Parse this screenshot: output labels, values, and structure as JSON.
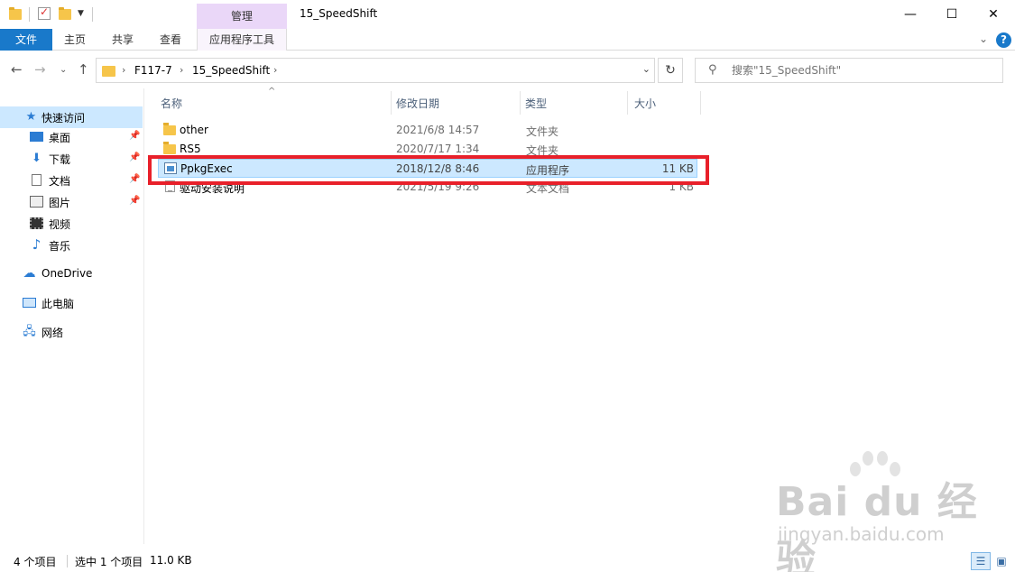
{
  "window": {
    "title": "15_SpeedShift",
    "manage_tab": "管理",
    "minimize": "—",
    "maximize": "☐",
    "close": "✕"
  },
  "ribbon": {
    "tabs": [
      "文件",
      "主页",
      "共享",
      "查看",
      "应用程序工具"
    ],
    "help": "?"
  },
  "address": {
    "crumbs": [
      "F117-7",
      "15_SpeedShift"
    ],
    "search_placeholder": "搜索\"15_SpeedShift\""
  },
  "sidebar": {
    "items": [
      {
        "label": "快速访问",
        "icon": "star-icon",
        "pinned": false,
        "selected": true
      },
      {
        "label": "桌面",
        "icon": "desktop-icon",
        "pinned": true
      },
      {
        "label": "下载",
        "icon": "download-icon",
        "pinned": true
      },
      {
        "label": "文档",
        "icon": "document-icon",
        "pinned": true
      },
      {
        "label": "图片",
        "icon": "picture-icon",
        "pinned": true
      },
      {
        "label": "视频",
        "icon": "video-icon",
        "pinned": false
      },
      {
        "label": "音乐",
        "icon": "music-icon",
        "pinned": false
      },
      {
        "label": "OneDrive",
        "icon": "cloud-icon"
      },
      {
        "label": "此电脑",
        "icon": "computer-icon"
      },
      {
        "label": "网络",
        "icon": "network-icon"
      }
    ]
  },
  "file_list": {
    "columns": [
      "名称",
      "修改日期",
      "类型",
      "大小"
    ],
    "rows": [
      {
        "name": "other",
        "date": "2021/6/8 14:57",
        "type": "文件夹",
        "size": "",
        "icon": "folder-icon"
      },
      {
        "name": "RS5",
        "date": "2020/7/17 1:34",
        "type": "文件夹",
        "size": "",
        "icon": "folder-icon"
      },
      {
        "name": "PpkgExec",
        "date": "2018/12/8 8:46",
        "type": "应用程序",
        "size": "11 KB",
        "icon": "application-icon",
        "selected": true
      },
      {
        "name": "驱动安装说明",
        "date": "2021/5/19 9:26",
        "type": "文本文档",
        "size": "1 KB",
        "icon": "text-document-icon"
      }
    ]
  },
  "status": {
    "item_count": "4 个项目",
    "selection": "选中 1 个项目",
    "size": "11.0 KB"
  },
  "watermark": {
    "logo": "Bai du 经验",
    "url": "jingyan.baidu.com"
  }
}
